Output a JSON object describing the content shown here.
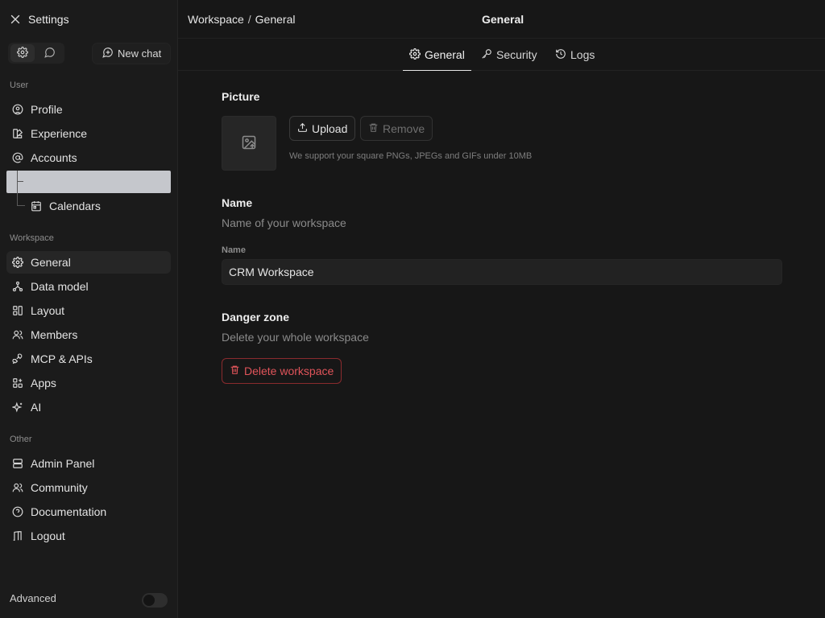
{
  "sidebar": {
    "title": "Settings",
    "new_chat_label": "New chat",
    "sections": {
      "user": "User",
      "workspace": "Workspace",
      "other": "Other"
    },
    "user_items": {
      "profile": "Profile",
      "experience": "Experience",
      "accounts": "Accounts",
      "calendars": "Calendars"
    },
    "workspace_items": {
      "general": "General",
      "data_model": "Data model",
      "layout": "Layout",
      "members": "Members",
      "mcp_apis": "MCP & APIs",
      "apps": "Apps",
      "ai": "AI"
    },
    "other_items": {
      "admin_panel": "Admin Panel",
      "community": "Community",
      "documentation": "Documentation",
      "logout": "Logout"
    },
    "advanced_label": "Advanced"
  },
  "header": {
    "breadcrumb": [
      "Workspace",
      "/",
      "General"
    ],
    "title": "General"
  },
  "tabs": {
    "general": "General",
    "security": "Security",
    "logs": "Logs"
  },
  "picture": {
    "heading": "Picture",
    "upload_label": "Upload",
    "remove_label": "Remove",
    "helper": "We support your square PNGs, JPEGs and GIFs under 10MB"
  },
  "name": {
    "heading": "Name",
    "description": "Name of your workspace",
    "field_label": "Name",
    "value": "CRM Workspace"
  },
  "danger": {
    "heading": "Danger zone",
    "description": "Delete your whole workspace",
    "delete_label": "Delete workspace"
  },
  "colors": {
    "background": "#171717",
    "sidebar": "#1b1b1b",
    "danger": "#e0545a"
  }
}
